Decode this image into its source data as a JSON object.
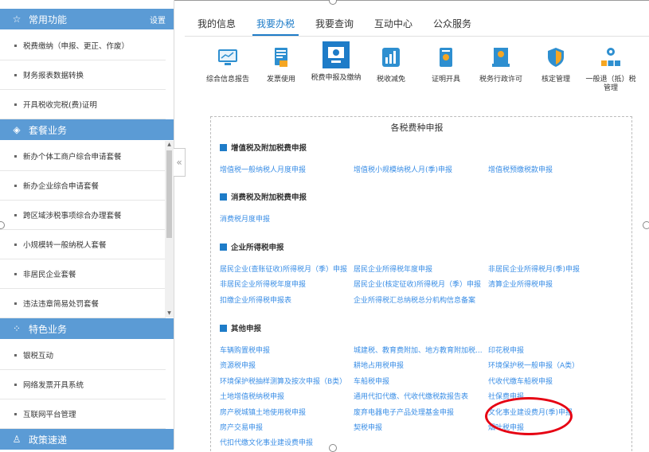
{
  "sidebar": {
    "sections": [
      {
        "title": "常用功能",
        "icon": "star-icon",
        "settings": "设置"
      },
      {
        "title": "套餐业务",
        "icon": "layers-icon"
      },
      {
        "title": "特色业务",
        "icon": "grid-icon"
      },
      {
        "title": "政策速递",
        "icon": "user-icon"
      }
    ],
    "common_items": [
      "税费缴纳（申报、更正、作废）",
      "财务报表数据转换",
      "开具税收完税(费)证明"
    ],
    "package_items": [
      "新办个体工商户综合申请套餐",
      "新办企业综合申请套餐",
      "跨区域涉税事项综合办理套餐",
      "小规模转一般纳税人套餐",
      "非居民企业套餐",
      "违法违章简易处罚套餐"
    ],
    "special_items": [
      "银税互动",
      "网络发票开具系统",
      "互联网平台管理"
    ],
    "collapse_glyph": "«"
  },
  "tabs": [
    "我的信息",
    "我要办税",
    "我要查询",
    "互动中心",
    "公众服务"
  ],
  "active_tab": "我要办税",
  "functions": [
    {
      "label": "综合信息报告",
      "icon": "report-chart-icon"
    },
    {
      "label": "发票使用",
      "icon": "invoice-icon"
    },
    {
      "label": "税费申报及缴纳",
      "icon": "tax-declaration-icon"
    },
    {
      "label": "税收减免",
      "icon": "tax-reduction-icon"
    },
    {
      "label": "证明开具",
      "icon": "certificate-icon"
    },
    {
      "label": "税务行政许可",
      "icon": "administrative-license-icon"
    },
    {
      "label": "核定管理",
      "icon": "shield-check-icon"
    },
    {
      "label": "一般退（抵）税管理",
      "icon": "refund-management-icon"
    }
  ],
  "panel_title": "各税费种申报",
  "categories": [
    {
      "title": "增值税及附加税费申报",
      "icon": "edit-icon",
      "links": [
        "增值税一般纳税人月度申报",
        "增值税小规模纳税人月(季)申报",
        "增值税预缴税款申报"
      ]
    },
    {
      "title": "消费税及附加税费申报",
      "icon": "bottle-icon",
      "links": [
        "消费税月度申报"
      ]
    },
    {
      "title": "企业所得税申报",
      "icon": "building-icon",
      "links": [
        "居民企业(查账征收)所得税月（季）申报",
        "居民企业所得税年度申报",
        "非居民企业所得税月(季)申报",
        "非居民企业所得税年度申报",
        "居民企业(核定征收)所得税月（季）申报",
        "清算企业所得税申报",
        "扣缴企业所得税申报表",
        "企业所得税汇总纳税总分机构信息备案"
      ]
    },
    {
      "title": "其他申报",
      "icon": "apps-icon",
      "links": [
        "车辆购置税申报",
        "城建税、教育费附加、地方教育附加税...",
        "印花税申报",
        "资源税申报",
        "耕地占用税申报",
        "环境保护税一般申报（A类）",
        "环境保护税抽样测算及按次申报（B类）",
        "车船税申报",
        "代收代缴车船税申报",
        "土地增值税纳税申报",
        "通用代扣代缴、代收代缴税款报告表",
        "社保费申报",
        "房产税城镇土地使用税申报",
        "废弃电器电子产品处理基金申报",
        "文化事业建设费月(季)申报",
        "房产交易申报",
        "契税申报",
        "烟叶税申报",
        "代扣代缴文化事业建设费申报"
      ]
    }
  ],
  "colors": {
    "sidebar_header": "#5b9bd5",
    "accent": "#1e7cc8",
    "link": "#3a8ee6",
    "annotation": "#e60012"
  }
}
